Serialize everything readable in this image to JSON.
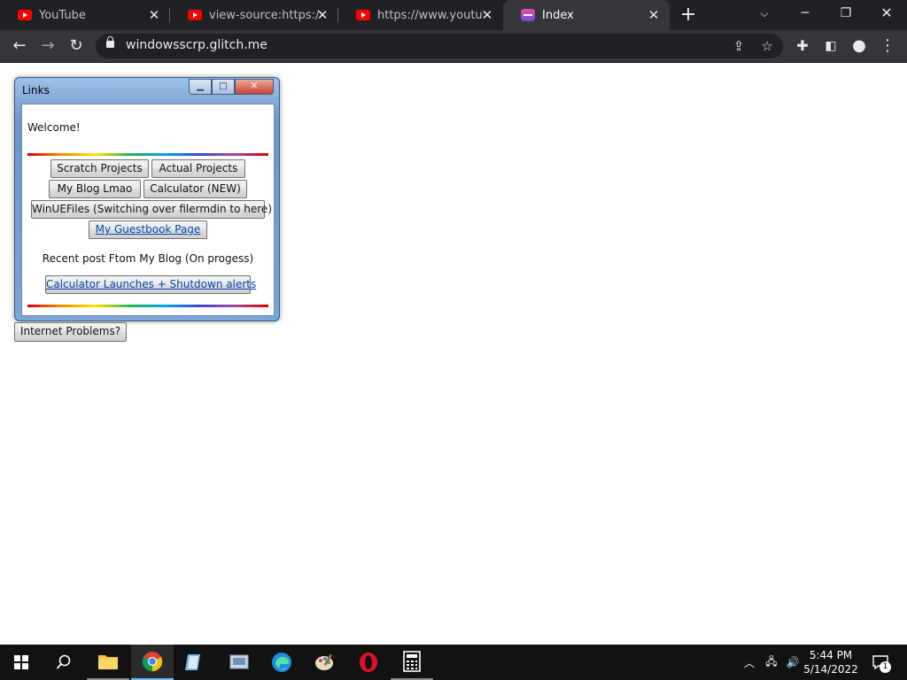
{
  "browser": {
    "tabs": [
      {
        "title": "YouTube",
        "active": false
      },
      {
        "title": "view-source:https://ww",
        "active": false
      },
      {
        "title": "https://www.youtube.c",
        "active": false
      },
      {
        "title": "Index",
        "active": true
      }
    ],
    "new_tab_icon": "plus-icon",
    "url": "windowsscrp.glitch.me"
  },
  "window": {
    "title": "Links",
    "welcome": "Welcome!",
    "buttons": {
      "scratch": "Scratch Projects",
      "actual": "Actual Projects",
      "blog": "My Blog Lmao",
      "calculator": "Calculator (NEW)",
      "winuefiles": "WinUEFiles (Switching over filermdin to here)",
      "guestbook": "My Guestbook Page"
    },
    "recent_label": "Recent post Ftom My Blog (On progess)",
    "recent_link": "Calculator Launches + Shutdown alerts"
  },
  "internet_button": "Internet Problems?",
  "taskbar": {
    "time": "5:44 PM",
    "date": "5/14/2022",
    "notification_count": "1"
  },
  "colors": {
    "tab_strip": "#202124",
    "toolbar": "#35363a",
    "link": "#0645ad",
    "taskbar": "#121212"
  }
}
